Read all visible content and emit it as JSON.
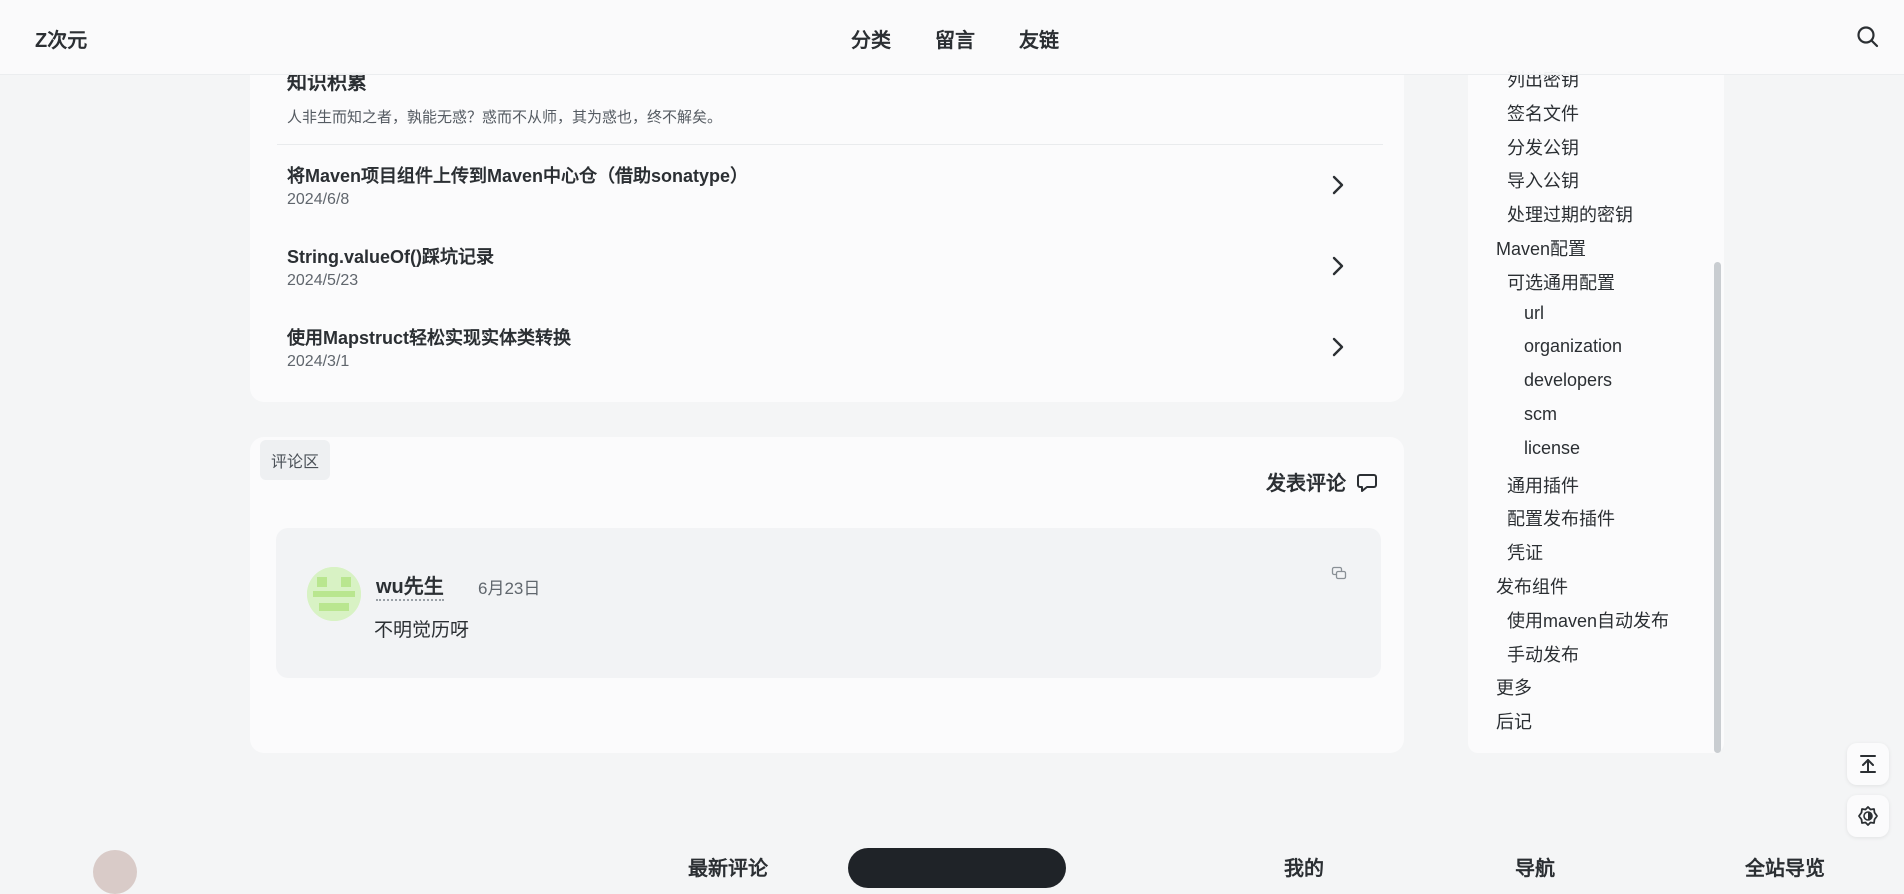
{
  "header": {
    "brand": "Z次元",
    "nav": [
      "分类",
      "留言",
      "友链"
    ],
    "search_icon": "search-icon"
  },
  "related": {
    "title": "知识积累",
    "desc": "人非生而知之者，孰能无惑？惑而不从师，其为惑也，终不解矣。",
    "posts": [
      {
        "title": "将Maven项目组件上传到Maven中心仓（借助sonatype）",
        "date": "2024/6/8"
      },
      {
        "title": "String.valueOf()踩坑记录",
        "date": "2024/5/23"
      },
      {
        "title": "使用Mapstruct轻松实现实体类转换",
        "date": "2024/3/1"
      }
    ]
  },
  "comments": {
    "tag": "评论区",
    "post_label": "发表评论",
    "items": [
      {
        "user": "wu先生",
        "date": "6月23日",
        "text": "不明觉历呀"
      }
    ]
  },
  "toc": {
    "items": [
      {
        "label": "列出密钥",
        "level": 2
      },
      {
        "label": "签名文件",
        "level": 2
      },
      {
        "label": "分发公钥",
        "level": 2
      },
      {
        "label": "导入公钥",
        "level": 2
      },
      {
        "label": "处理过期的密钥",
        "level": 2
      },
      {
        "label": "Maven配置",
        "level": 1
      },
      {
        "label": "可选通用配置",
        "level": 2
      },
      {
        "label": "url",
        "level": 3
      },
      {
        "label": "organization",
        "level": 3
      },
      {
        "label": "developers",
        "level": 3
      },
      {
        "label": "scm",
        "level": 3
      },
      {
        "label": "license",
        "level": 3
      },
      {
        "label": "通用插件",
        "level": 2
      },
      {
        "label": "配置发布插件",
        "level": 2
      },
      {
        "label": "凭证",
        "level": 2
      },
      {
        "label": "发布组件",
        "level": 1
      },
      {
        "label": "使用maven自动发布",
        "level": 2
      },
      {
        "label": "手动发布",
        "level": 2
      },
      {
        "label": "更多",
        "level": 1
      },
      {
        "label": "后记",
        "level": 1
      }
    ]
  },
  "floating": {
    "top_icon": "back-to-top-icon",
    "theme_icon": "theme-toggle-icon"
  },
  "footer": {
    "col1": "最新评论",
    "col2": "我的",
    "col3": "导航",
    "col4": "全站导览"
  }
}
